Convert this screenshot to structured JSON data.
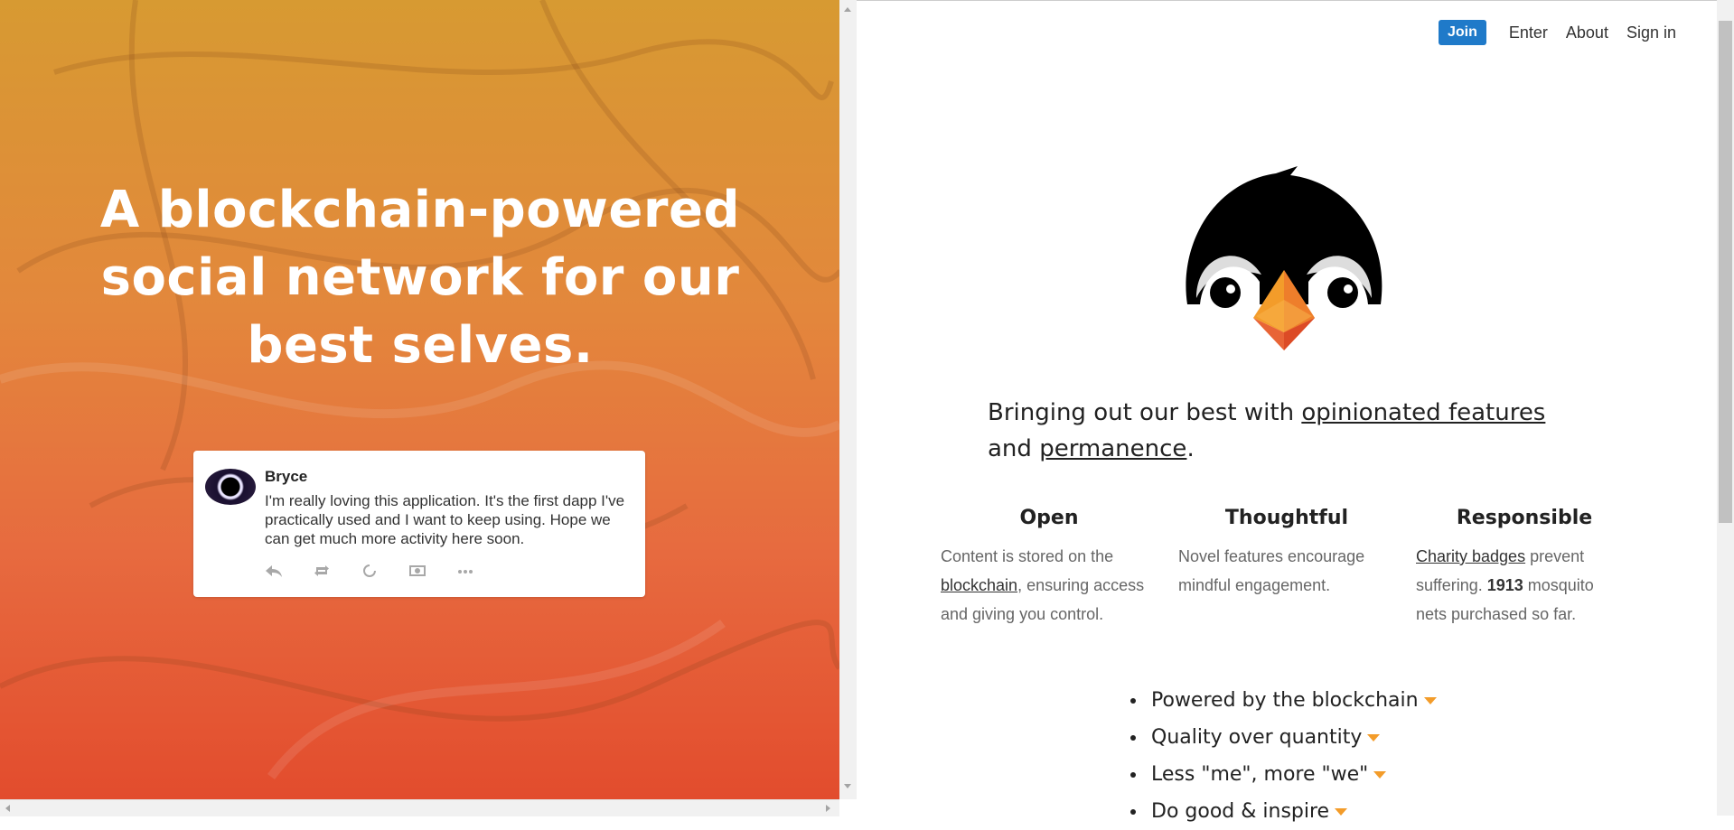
{
  "hero": {
    "title": "A blockchain-powered social network for our best selves."
  },
  "tweet": {
    "author": "Bryce",
    "text": "I'm really loving this application. It's the first dapp I've practically used and I want to keep using. Hope we can get much more activity here soon.",
    "actions": [
      "reply-icon",
      "retweet-icon",
      "like-icon",
      "tip-icon",
      "more-icon"
    ]
  },
  "nav": {
    "join": "Join",
    "enter": "Enter",
    "about": "About",
    "sign_in": "Sign in"
  },
  "tagline": {
    "prefix": "Bringing out our best with ",
    "link1": "opinionated features",
    "middle": " and ",
    "link2": "permanence",
    "suffix": "."
  },
  "features": {
    "open": {
      "title": "Open",
      "text_before": "Content is stored on the ",
      "link": "blockchain",
      "text_after": ", ensuring access and giving you control."
    },
    "thoughtful": {
      "title": "Thoughtful",
      "text": "Novel features encourage mindful engagement."
    },
    "responsible": {
      "title": "Responsible",
      "link": "Charity badges",
      "text_before": " prevent suffering. ",
      "count": "1913",
      "text_after": " mosquito nets purchased so far."
    }
  },
  "bullets": [
    "Powered by the blockchain",
    "Quality over quantity",
    "Less \"me\", more \"we\"",
    "Do good & inspire"
  ],
  "colors": {
    "join_button": "#1f7ac9",
    "caret": "#f39c2a",
    "hero_gradient_top": "#d79a32",
    "hero_gradient_bottom": "#e24a2c"
  }
}
